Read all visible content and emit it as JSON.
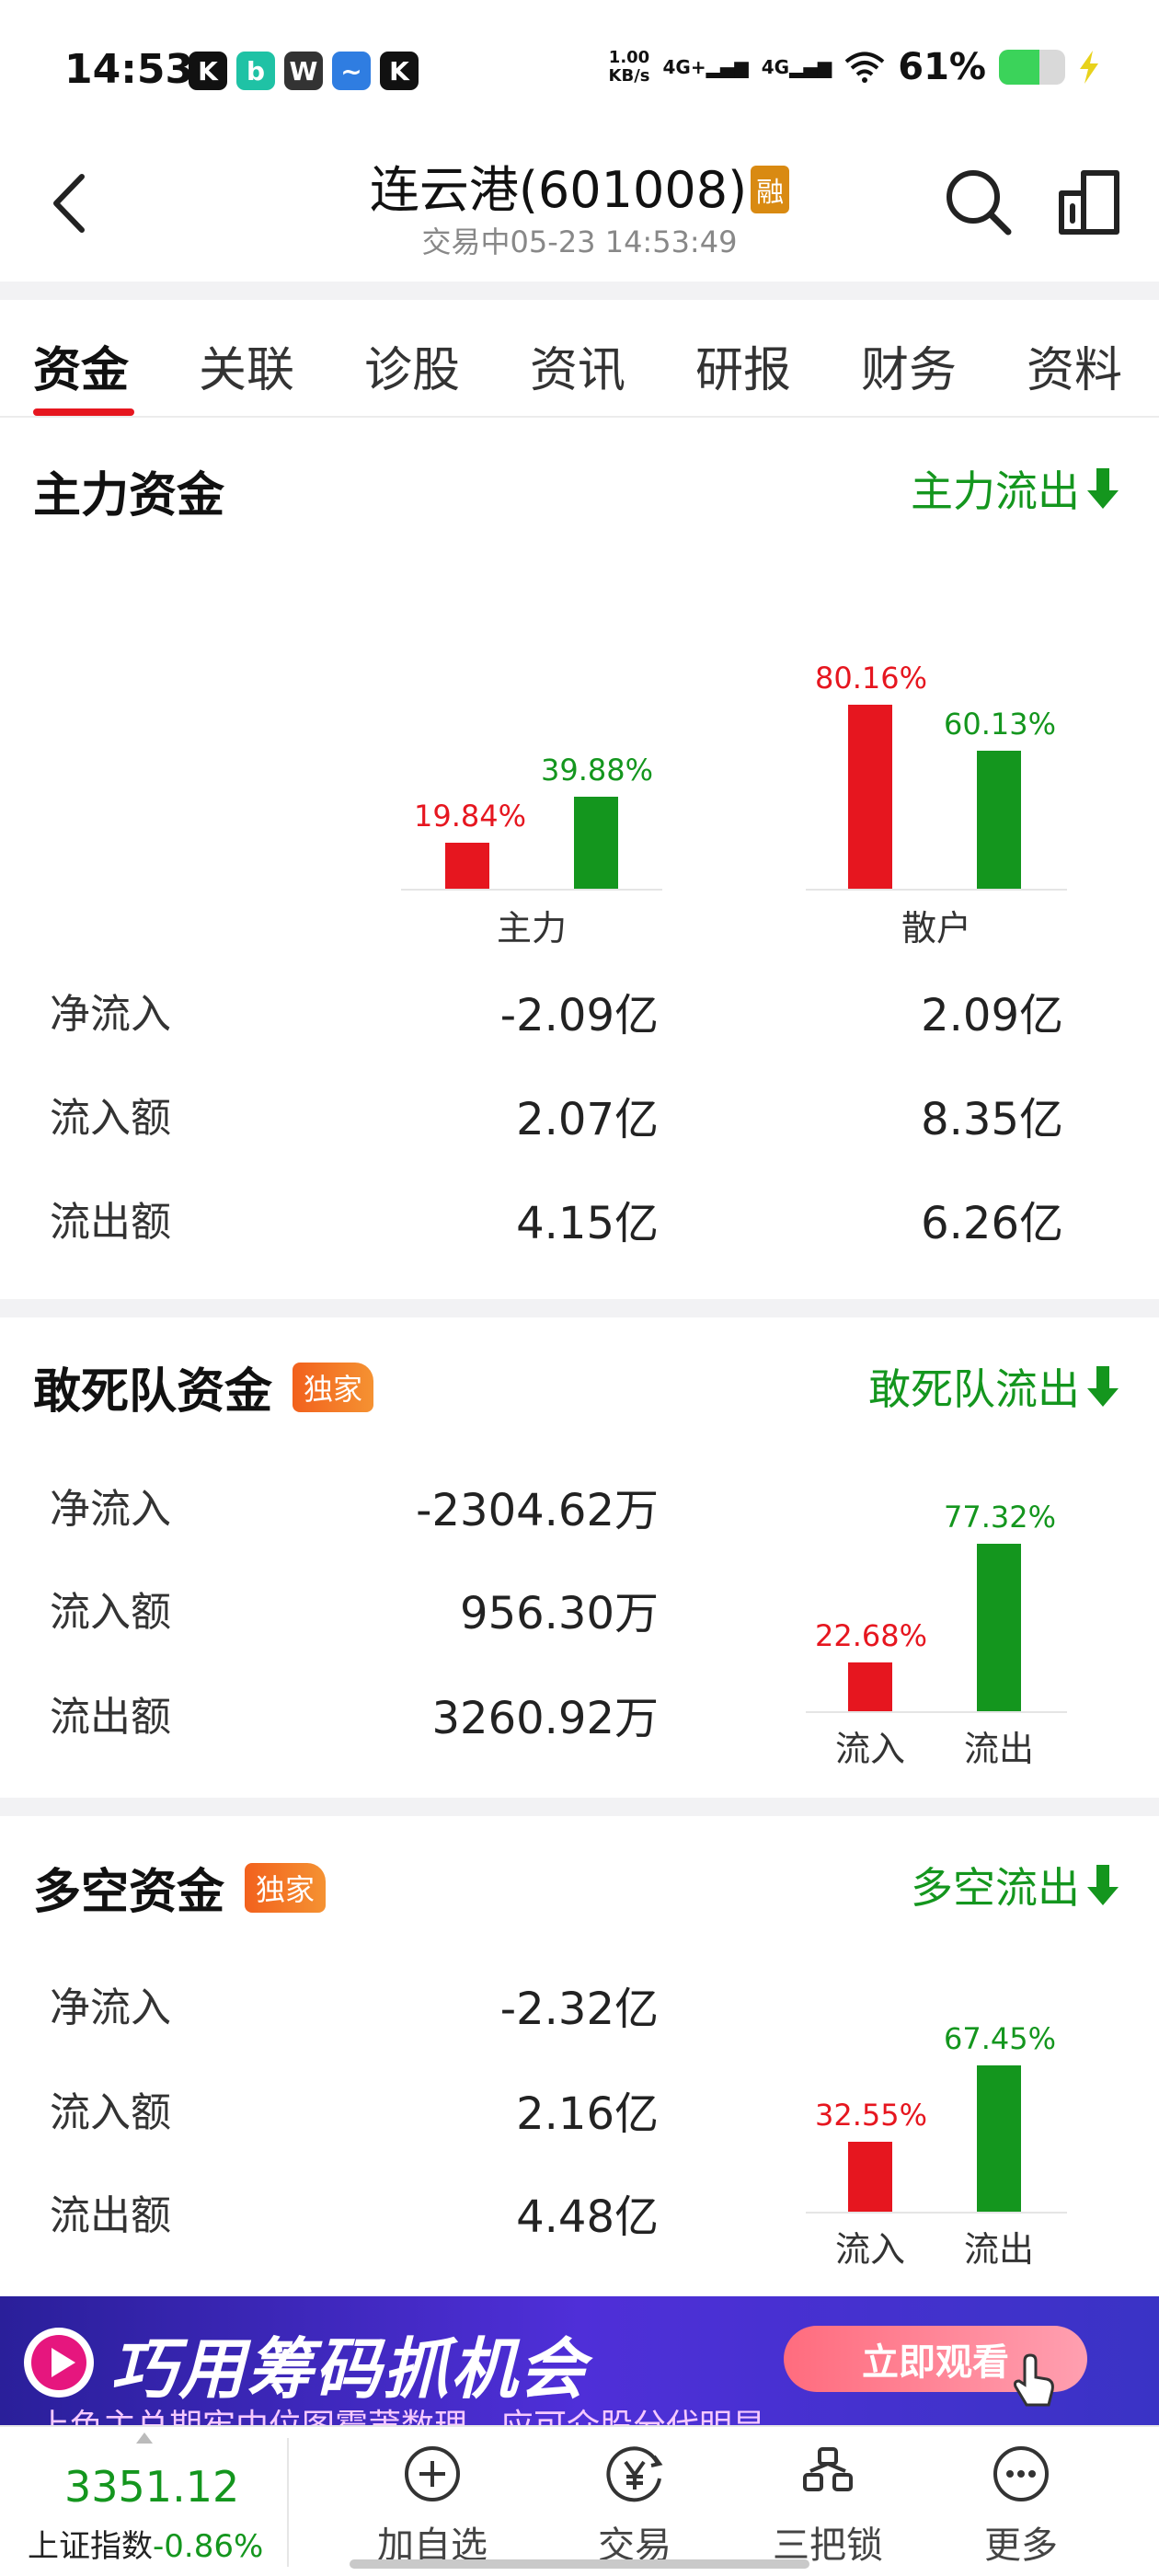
{
  "status_bar": {
    "time": "14:53",
    "apps": [
      "K",
      "b",
      "W",
      "~",
      "K"
    ],
    "speed_value": "1.00",
    "speed_unit": "KB/s",
    "signal1": "4G+",
    "signal2": "4G",
    "battery_text": "61%",
    "battery_level": 0.61
  },
  "nav": {
    "title": "连云港(601008)",
    "badge": "融",
    "subtitle": "交易中05-23 14:53:49"
  },
  "tabs": [
    {
      "label": "资金",
      "active": true
    },
    {
      "label": "关联"
    },
    {
      "label": "诊股"
    },
    {
      "label": "资讯"
    },
    {
      "label": "研报"
    },
    {
      "label": "财务"
    },
    {
      "label": "资料"
    }
  ],
  "main_funds": {
    "title": "主力资金",
    "link": "主力流出",
    "row_labels": [
      "净流入",
      "流入额",
      "流出额"
    ],
    "main": {
      "net": "-2.09亿",
      "inflow": "2.07亿",
      "outflow": "4.15亿"
    },
    "retail": {
      "net": "2.09亿",
      "inflow": "8.35亿",
      "outflow": "6.26亿"
    }
  },
  "daredevil_funds": {
    "title": "敢死队资金",
    "badge": "独家",
    "link": "敢死队流出",
    "rows": [
      {
        "label": "净流入",
        "value": "-2304.62万"
      },
      {
        "label": "流入额",
        "value": "956.30万"
      },
      {
        "label": "流出额",
        "value": "3260.92万"
      }
    ]
  },
  "longshort_funds": {
    "title": "多空资金",
    "badge": "独家",
    "link": "多空流出",
    "rows": [
      {
        "label": "净流入",
        "value": "-2.32亿"
      },
      {
        "label": "流入额",
        "value": "2.16亿"
      },
      {
        "label": "流出额",
        "value": "4.48亿"
      }
    ]
  },
  "chart_data": [
    {
      "type": "bar",
      "categories": [
        "主力",
        "散户"
      ],
      "series": [
        {
          "values": [
            19.84,
            80.16
          ],
          "labels": [
            "19.84%",
            "80.16%"
          ],
          "color": "#e6161f"
        },
        {
          "values": [
            39.88,
            60.13
          ],
          "labels": [
            "39.88%",
            "60.13%"
          ],
          "color": "#14961e"
        }
      ],
      "ylim": [
        0,
        100
      ],
      "grid": false
    },
    {
      "type": "bar",
      "categories": [
        "流入",
        "流出"
      ],
      "values": [
        22.68,
        77.32
      ],
      "labels": [
        "22.68%",
        "77.32%"
      ],
      "colors": [
        "#e6161f",
        "#14961e"
      ],
      "ylim": [
        0,
        100
      ],
      "grid": false
    },
    {
      "type": "bar",
      "categories": [
        "流入",
        "流出"
      ],
      "values": [
        32.55,
        67.45
      ],
      "labels": [
        "32.55%",
        "67.45%"
      ],
      "colors": [
        "#e6161f",
        "#14961e"
      ],
      "ylim": [
        0,
        100
      ],
      "grid": false
    }
  ],
  "banner": {
    "title": "巧用筹码抓机会",
    "button": "立即观看",
    "subtitle": "上色主总期牢中位图霉莆数理，应可介股分代明显"
  },
  "bottom_bar": {
    "index_value": "3351.12",
    "index_name": "上证指数",
    "index_change": "-0.86%",
    "items": [
      {
        "label": "加自选",
        "icon": "plus-circle-icon"
      },
      {
        "label": "交易",
        "icon": "yen-icon"
      },
      {
        "label": "三把锁",
        "icon": "lock-people-icon"
      },
      {
        "label": "更多",
        "icon": "more-icon"
      }
    ]
  }
}
